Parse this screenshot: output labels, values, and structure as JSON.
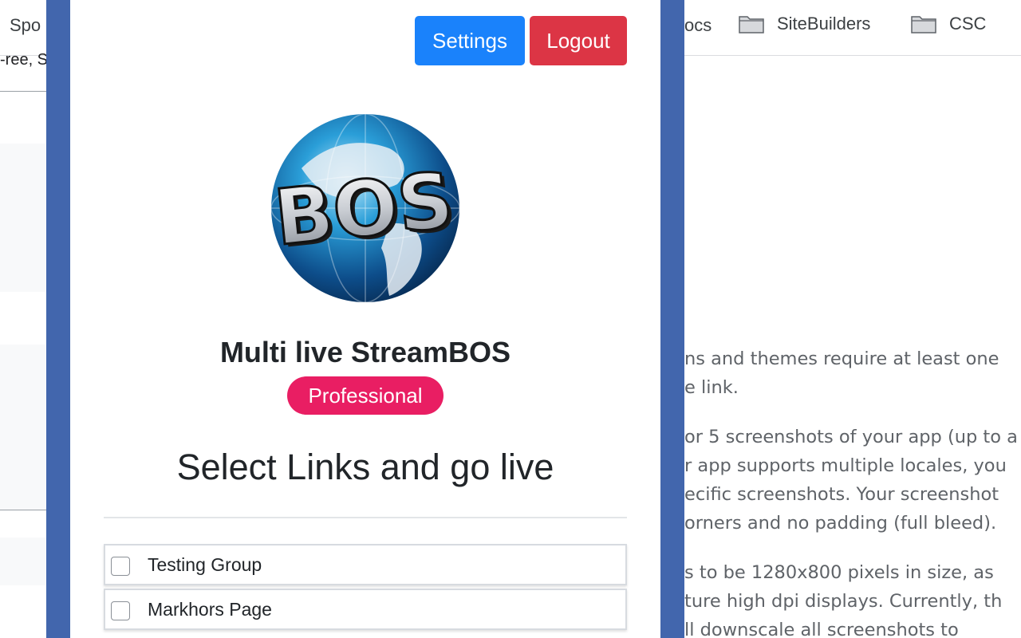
{
  "bookmarks": {
    "partial_left": "Spo",
    "partial_right": "ocs",
    "items": [
      {
        "label": "SiteBuilders"
      },
      {
        "label": "CSC"
      }
    ]
  },
  "left_strip_text": "-ree, S",
  "background_text": {
    "p1": [
      "ns and themes require at least one",
      "e link."
    ],
    "p2": [
      "or 5 screenshots of your app (up to a",
      "r app supports multiple locales, you",
      "ecific screenshots. Your screenshot",
      "orners and no padding (full bleed)."
    ],
    "p3": [
      "s to be 1280x800 pixels in size, as",
      "ture high dpi displays. Currently, th",
      "ll downscale all screenshots to"
    ]
  },
  "popup": {
    "settings_label": "Settings",
    "logout_label": "Logout",
    "logo_text": "BOS",
    "app_title": "Multi live StreamBOS",
    "plan_badge": "Professional",
    "section_heading": "Select Links and go live",
    "links": [
      {
        "label": "Testing Group",
        "checked": false
      },
      {
        "label": "Markhors Page",
        "checked": false
      }
    ]
  },
  "colors": {
    "frame": "#4266ad",
    "settings_button": "#1a82fb",
    "logout_button": "#dc3545",
    "badge": "#e91e63"
  }
}
